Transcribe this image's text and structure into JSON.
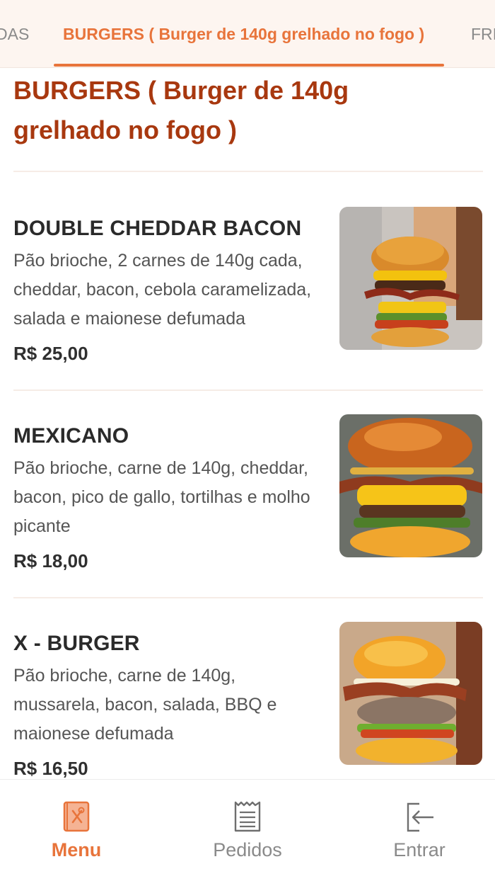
{
  "tabs": {
    "previous": "BEBIDAS",
    "active": "BURGERS ( Burger de 140g grelhado no fogo )",
    "next": "FRITAS"
  },
  "section": {
    "title": "BURGERS ( Burger de 140g grelhado no fogo )"
  },
  "products": [
    {
      "name": "DOUBLE CHEDDAR BACON",
      "description": "Pão brioche, 2 carnes de 140g cada, cheddar, bacon, cebola caramelizada, salada e maionese defumada",
      "price": "R$ 25,00",
      "image_icon": "double-cheddar-bacon-burger-photo"
    },
    {
      "name": "MEXICANO",
      "description": "Pão brioche, carne de 140g, cheddar, bacon, pico de gallo, tortilhas e molho picante",
      "price": "R$ 18,00",
      "image_icon": "mexicano-burger-photo"
    },
    {
      "name": "X - BURGER",
      "description": "Pão brioche, carne de 140g, mussarela, bacon, salada, BBQ e maionese defumada",
      "price": "R$ 16,50",
      "image_icon": "x-burger-photo"
    }
  ],
  "bottom_nav": {
    "menu": {
      "label": "Menu",
      "icon": "menu-book-icon"
    },
    "orders": {
      "label": "Pedidos",
      "icon": "receipt-icon"
    },
    "login": {
      "label": "Entrar",
      "icon": "login-icon"
    }
  },
  "colors": {
    "accent": "#e8743b",
    "section_title": "#a8380f",
    "tabbar_background": "#fdf5f0"
  }
}
